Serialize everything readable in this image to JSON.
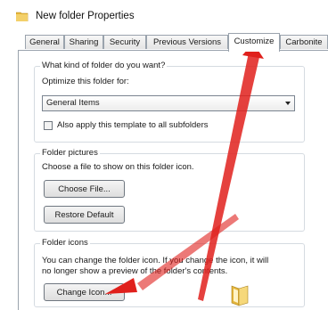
{
  "window": {
    "title": "New folder Properties",
    "icon": "folder-icon"
  },
  "tabs": [
    {
      "label": "General"
    },
    {
      "label": "Sharing"
    },
    {
      "label": "Security"
    },
    {
      "label": "Previous Versions"
    },
    {
      "label": "Customize",
      "active": true
    },
    {
      "label": "Carbonite"
    }
  ],
  "folder_type": {
    "group_label": "What kind of folder do you want?",
    "optimize_label": "Optimize this folder for:",
    "selected_option": "General Items",
    "apply_subfolders_label": "Also apply this template to all subfolders",
    "apply_subfolders_checked": false
  },
  "folder_pictures": {
    "group_label": "Folder pictures",
    "description": "Choose a file to show on this folder icon.",
    "choose_file_button": "Choose File...",
    "restore_default_button": "Restore Default"
  },
  "folder_icons": {
    "group_label": "Folder icons",
    "description_line1": "You can change the folder icon. If you change the icon, it will",
    "description_line2": "no longer show a preview of the folder's contents.",
    "change_icon_button": "Change Icon...",
    "preview_icon": "folder-icon"
  },
  "annotations": {
    "arrow_color": "#e0201c"
  }
}
